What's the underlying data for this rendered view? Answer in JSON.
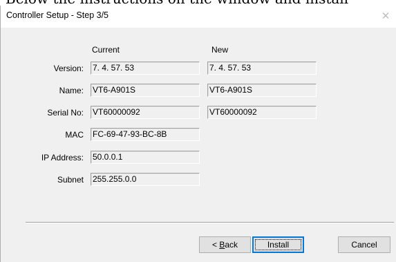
{
  "window": {
    "title": "Controller Setup - Step 3/5",
    "close_symbol": "✕",
    "close_icon": "close-icon",
    "behind_text": "Below the instructions on the window and install"
  },
  "columns": {
    "current": "Current",
    "new": "New"
  },
  "rows": [
    {
      "label": "Version:",
      "current": "7. 4. 57. 53",
      "new": "7. 4. 57. 53"
    },
    {
      "label": "Name:",
      "current": "VT6-A901S",
      "new": "VT6-A901S"
    },
    {
      "label": "Serial No:",
      "current": "VT60000092",
      "new": "VT60000092"
    },
    {
      "label": "MAC",
      "current": "FC-69-47-93-BC-8B"
    },
    {
      "label": "IP Address:",
      "current": "50.0.0.1"
    },
    {
      "label": "Subnet",
      "current": "255.255.0.0"
    }
  ],
  "buttons": {
    "back_prefix": "< ",
    "back_mnemonic": "B",
    "back_rest": "ack",
    "install": "Install",
    "cancel": "Cancel"
  }
}
